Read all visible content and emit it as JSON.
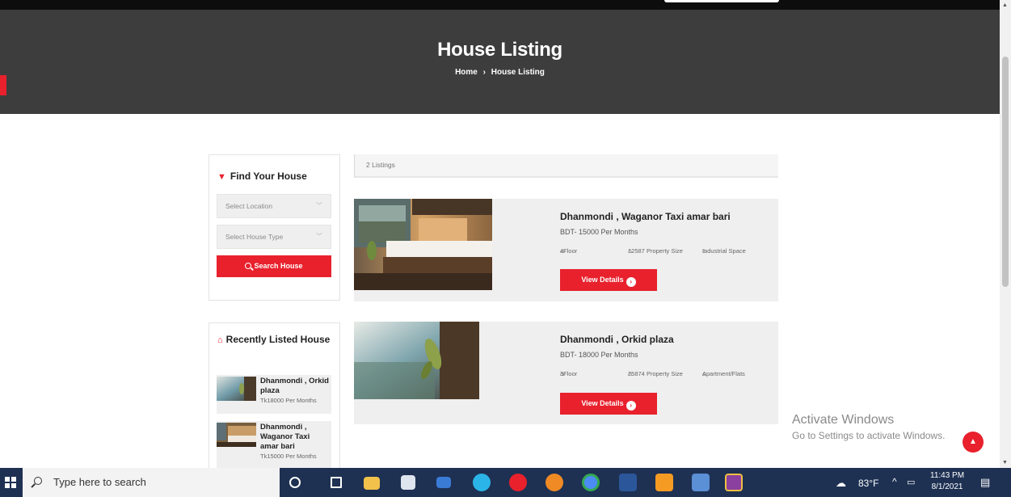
{
  "banner": {
    "title": "House Listing",
    "breadcrumb": {
      "home": "Home",
      "separator": "›",
      "current": "House Listing"
    }
  },
  "find_box": {
    "title": "Find Your House",
    "icon": "filter-icon",
    "location_placeholder": "Select Location",
    "type_placeholder": "Select House Type",
    "search_label": "Search House"
  },
  "recent_box": {
    "title": "Recently Listed House",
    "icon": "home-icon",
    "items": [
      {
        "title": "Dhanmondi , Orkid plaza",
        "price": "Tk18000 Per Months"
      },
      {
        "title": "Dhanmondi , Waganor Taxi amar bari",
        "price": "Tk15000 Per Months"
      }
    ]
  },
  "listing": {
    "count": "2 Listings",
    "cards": [
      {
        "title": "Dhanmondi , Waganor Taxi amar bari",
        "price": "BDT- 15000 Per Months",
        "floor": "4Floor",
        "size": "12587 Property Size",
        "type": "Industrial Space",
        "button": "View Details"
      },
      {
        "title": "Dhanmondi , Orkid plaza",
        "price": "BDT- 18000 Per Months",
        "floor": "3Floor",
        "size": "25874 Property Size",
        "type": "Apartment/Flats",
        "button": "View Details"
      }
    ]
  },
  "watermark": {
    "line1": "Activate Windows",
    "line2": "Go to Settings to activate Windows."
  },
  "taskbar": {
    "search_placeholder": "Type here to search",
    "weather": "83°F",
    "time": "11:43 PM",
    "date": "8/1/2021"
  },
  "colors": {
    "accent": "#e8212d",
    "banner": "#3d3d3d",
    "taskbar": "#1e3153"
  }
}
